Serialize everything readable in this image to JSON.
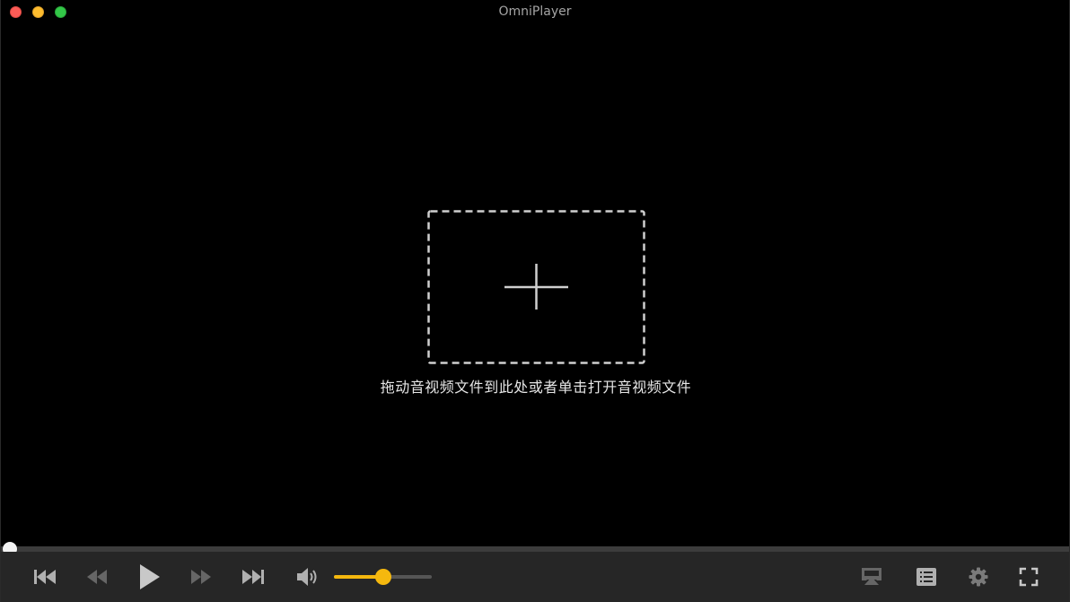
{
  "window": {
    "title": "OmniPlayer"
  },
  "drop_zone": {
    "hint": "拖动音视频文件到此处或者单击打开音视频文件",
    "icon": "plus-icon"
  },
  "playback": {
    "progress": 0.0,
    "volume": 0.5
  },
  "controls": {
    "left": [
      {
        "name": "previous-track-button",
        "icon": "skip-back-icon"
      },
      {
        "name": "rewind-button",
        "icon": "rewind-icon"
      },
      {
        "name": "play-button",
        "icon": "play-icon"
      },
      {
        "name": "fast-forward-button",
        "icon": "fast-forward-icon"
      },
      {
        "name": "next-track-button",
        "icon": "skip-forward-icon"
      },
      {
        "name": "volume-button",
        "icon": "speaker-icon"
      }
    ],
    "right": [
      {
        "name": "airplay-button",
        "icon": "airplay-icon"
      },
      {
        "name": "playlist-button",
        "icon": "list-icon"
      },
      {
        "name": "settings-button",
        "icon": "gear-icon"
      },
      {
        "name": "fullscreen-button",
        "icon": "fullscreen-icon"
      }
    ]
  },
  "colors": {
    "accent": "#f5b80e",
    "background": "#000000",
    "control_bar": "#262626",
    "icon": "#b0b0b0",
    "icon_dim": "#666666",
    "close": "#fc5c57",
    "minimize": "#fdbc2e",
    "maximize": "#33c748"
  }
}
